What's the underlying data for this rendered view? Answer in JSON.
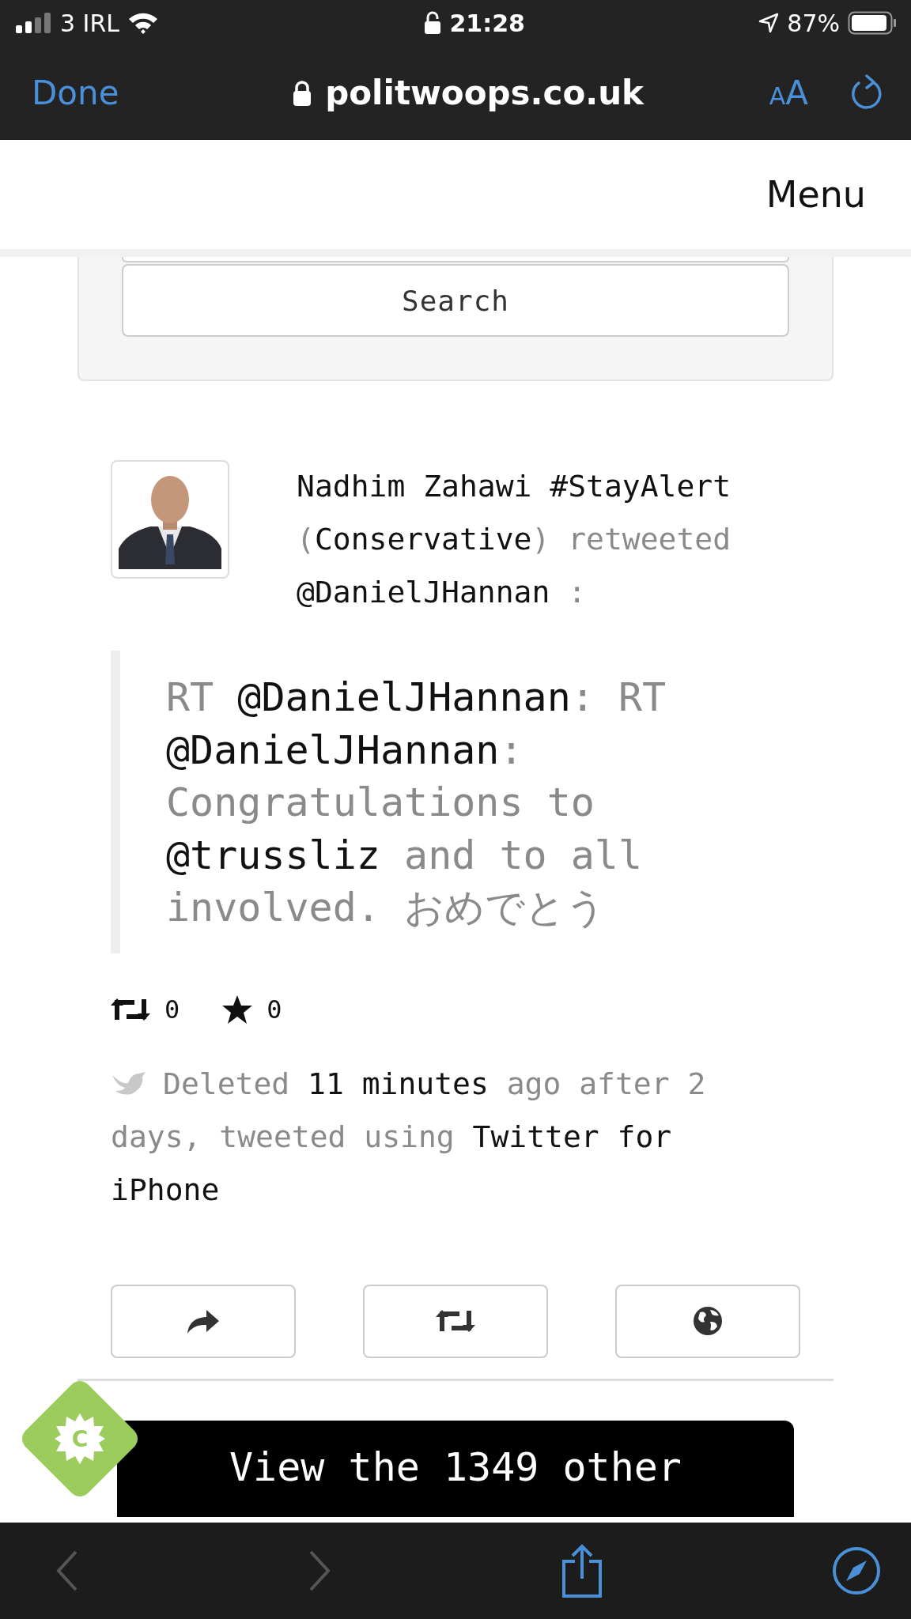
{
  "status_bar": {
    "carrier": "3 IRL",
    "time": "21:28",
    "battery": "87%"
  },
  "browser_bar": {
    "done": "Done",
    "url": "politwoops.co.uk",
    "text_size": [
      "A",
      "A"
    ]
  },
  "header": {
    "menu": "Menu"
  },
  "search": {
    "button": "Search"
  },
  "tweet": {
    "byline": [
      {
        "text": "Nadhim Zahawi #StayAlert ",
        "emphasis": true
      },
      {
        "text": "(",
        "emphasis": false
      },
      {
        "text": "Conservative",
        "emphasis": true
      },
      {
        "text": ") retweeted ",
        "emphasis": false
      },
      {
        "text": "@DanielJHannan",
        "emphasis": true
      },
      {
        "text": " :",
        "emphasis": false
      }
    ],
    "body": [
      {
        "text": "RT ",
        "emphasis": false
      },
      {
        "text": "@DanielJHannan",
        "emphasis": true
      },
      {
        "text": ": RT ",
        "emphasis": false
      },
      {
        "text": "@DanielJHannan",
        "emphasis": true
      },
      {
        "text": ": Congratulations to ",
        "emphasis": false
      },
      {
        "text": "@trussliz",
        "emphasis": true
      },
      {
        "text": " and to all involved. おめでとう",
        "emphasis": false
      }
    ],
    "retweets": "0",
    "favorites": "0",
    "deleted": [
      {
        "text": "Deleted ",
        "emphasis": false
      },
      {
        "text": "11 minutes",
        "emphasis": true
      },
      {
        "text": " ago after 2 days, tweeted using ",
        "emphasis": false
      },
      {
        "text": "Twitter for iPhone",
        "emphasis": true
      }
    ],
    "actions": [
      {
        "kind": "share"
      },
      {
        "kind": "retweet"
      },
      {
        "kind": "web"
      }
    ]
  },
  "more_button": "View the 1349 other",
  "badge": "C"
}
